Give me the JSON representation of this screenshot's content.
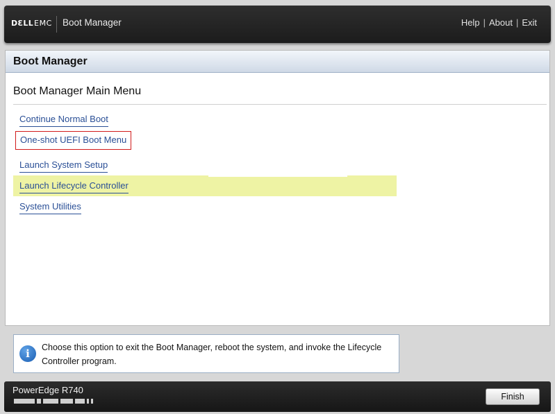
{
  "header": {
    "brand_dell": "DƐLL",
    "brand_emc": "EMC",
    "app_title": "Boot Manager",
    "links": {
      "help": "Help",
      "about": "About",
      "exit": "Exit",
      "separator": "|"
    }
  },
  "panel": {
    "title": "Boot Manager",
    "menu_title": "Boot Manager Main Menu",
    "items": [
      {
        "label": "Continue Normal Boot"
      },
      {
        "label": "One-shot UEFI Boot Menu"
      },
      {
        "label": "Launch System Setup"
      },
      {
        "label": "Launch Lifecycle Controller"
      },
      {
        "label": "System Utilities"
      }
    ]
  },
  "info": {
    "icon_glyph": "i",
    "text": "Choose this option to exit the Boot Manager, reboot the system, and invoke the Lifecycle Controller program."
  },
  "footer": {
    "model": "PowerEdge R740",
    "finish_label": "Finish"
  },
  "colors": {
    "link": "#2a4f96",
    "highlight": "#eef3a4",
    "focus_border": "#d11a1a",
    "header_bg": "#1c1c1c"
  }
}
